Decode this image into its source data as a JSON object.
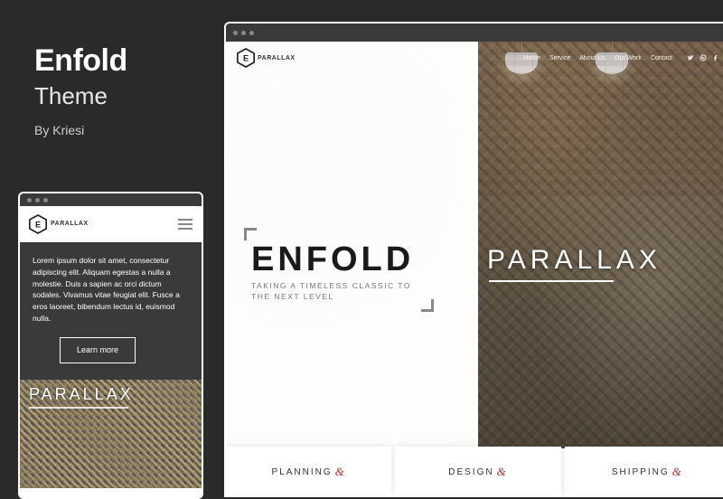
{
  "info": {
    "title": "Enfold",
    "subtitle": "Theme",
    "author": "By Kriesi"
  },
  "mobile": {
    "logo_text": "PARALLAX",
    "lorem": "Lorem ipsum dolor sit amet, consectetur adipiscing elit. Aliquam egestas a nulla a molestie. Duis a sapien ac orci dictum sodales. Vivamus vitae feugiat elit. Fusce a eros laoreet, bibendum lectus id, euismod nulla.",
    "learn_more": "Learn more",
    "parallax_label": "PARALLAX"
  },
  "desktop": {
    "logo_text": "PARALLAX",
    "menu": {
      "home": "Home",
      "service": "Service",
      "about": "About Us",
      "work": "Our Work",
      "contact": "Contact"
    },
    "hero_title": "ENFOLD",
    "hero_tag_l1": "TAKING A TIMELESS CLASSIC TO",
    "hero_tag_l2": "THE NEXT LEVEL",
    "parallax_label": "PARALLAX",
    "cards": {
      "c1": "PLANNING",
      "c2": "DESIGN",
      "c3": "SHIPPING",
      "amp": "&"
    }
  }
}
